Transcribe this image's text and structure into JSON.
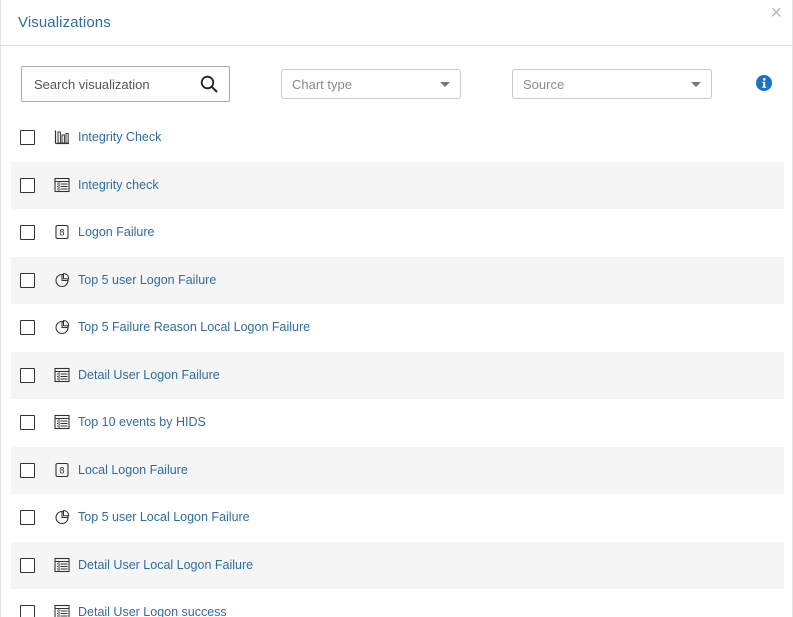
{
  "header": {
    "title": "Visualizations",
    "close_label": "×"
  },
  "filters": {
    "search_placeholder": "Search visualization",
    "chart_type_placeholder": "Chart type",
    "source_placeholder": "Source"
  },
  "items": [
    {
      "label": "Integrity Check",
      "icon": "bar-chart-icon"
    },
    {
      "label": "Integrity check",
      "icon": "table-icon"
    },
    {
      "label": "Logon Failure",
      "icon": "metric-number-icon"
    },
    {
      "label": "Top 5 user Logon Failure",
      "icon": "pie-chart-icon"
    },
    {
      "label": "Top 5 Failure Reason Local Logon Failure",
      "icon": "pie-chart-icon"
    },
    {
      "label": "Detail User Logon Failure",
      "icon": "table-icon"
    },
    {
      "label": "Top 10 events by HIDS",
      "icon": "table-icon"
    },
    {
      "label": "Local Logon Failure",
      "icon": "metric-number-icon"
    },
    {
      "label": "Top 5 user Local Logon Failure",
      "icon": "pie-chart-icon"
    },
    {
      "label": "Detail User Local Logon Failure",
      "icon": "table-icon"
    },
    {
      "label": "Detail User Logon success",
      "icon": "table-icon"
    }
  ],
  "colors": {
    "accent": "#2e6da4",
    "info": "#1a73c9",
    "row_alt": "#f5f5f5"
  }
}
